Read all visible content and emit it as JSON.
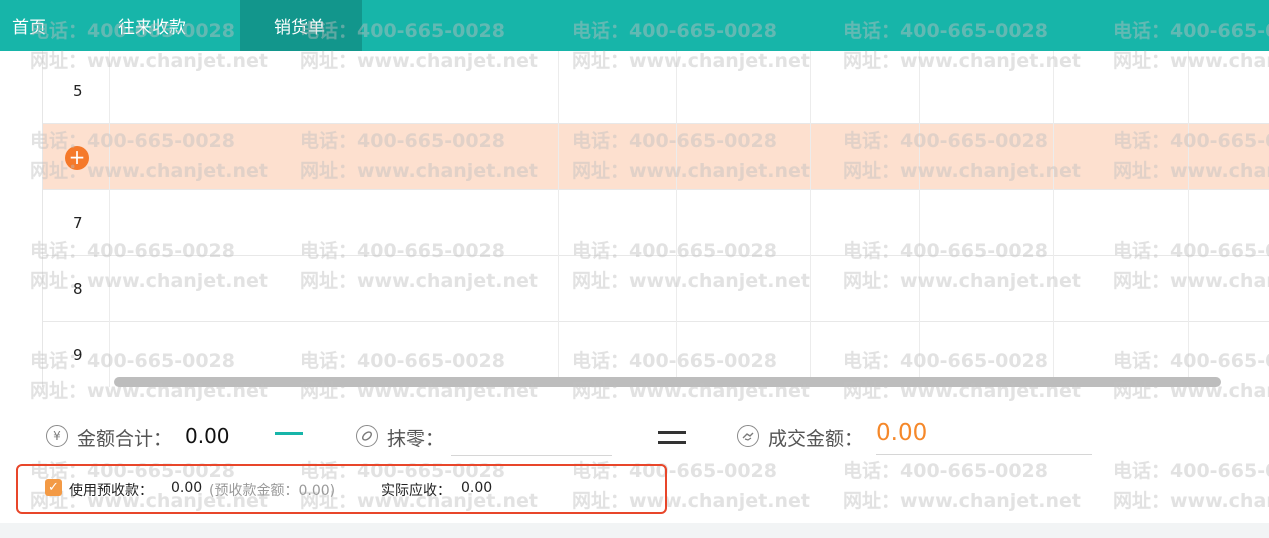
{
  "tabs": [
    {
      "label": "首页"
    },
    {
      "label": "往来收款"
    },
    {
      "label": "销货单",
      "active": true
    }
  ],
  "watermark": {
    "phone": "电话：400-665-0028",
    "site": "网址：www.chanjet.net"
  },
  "table": {
    "row_numbers": [
      "5",
      "",
      "7",
      "8",
      "9"
    ],
    "add_row_symbol": "+",
    "highlighted_row_index": 1
  },
  "totals": {
    "amount_icon": "¥",
    "amount_label": "金额合计：",
    "amount_value": "0.00",
    "rounding_icon": "eraser-icon",
    "rounding_label": "抹零：",
    "rounding_value": "",
    "deal_icon": "handshake-icon",
    "deal_label": "成交金额：",
    "deal_value": "0.00"
  },
  "prepaid": {
    "checked": true,
    "check_symbol": "✓",
    "label": "使用预收款：",
    "value": "0.00",
    "balance_text": "(预收款金额：0.00)",
    "actual_label": "实际应收：",
    "actual_value": "0.00"
  },
  "colors": {
    "header_bg": "#17b5a9",
    "active_tab_bg": "#12968c",
    "highlight_row": "#fde0cf",
    "accent_orange": "#f5882a",
    "alert_border": "#e8462a"
  }
}
